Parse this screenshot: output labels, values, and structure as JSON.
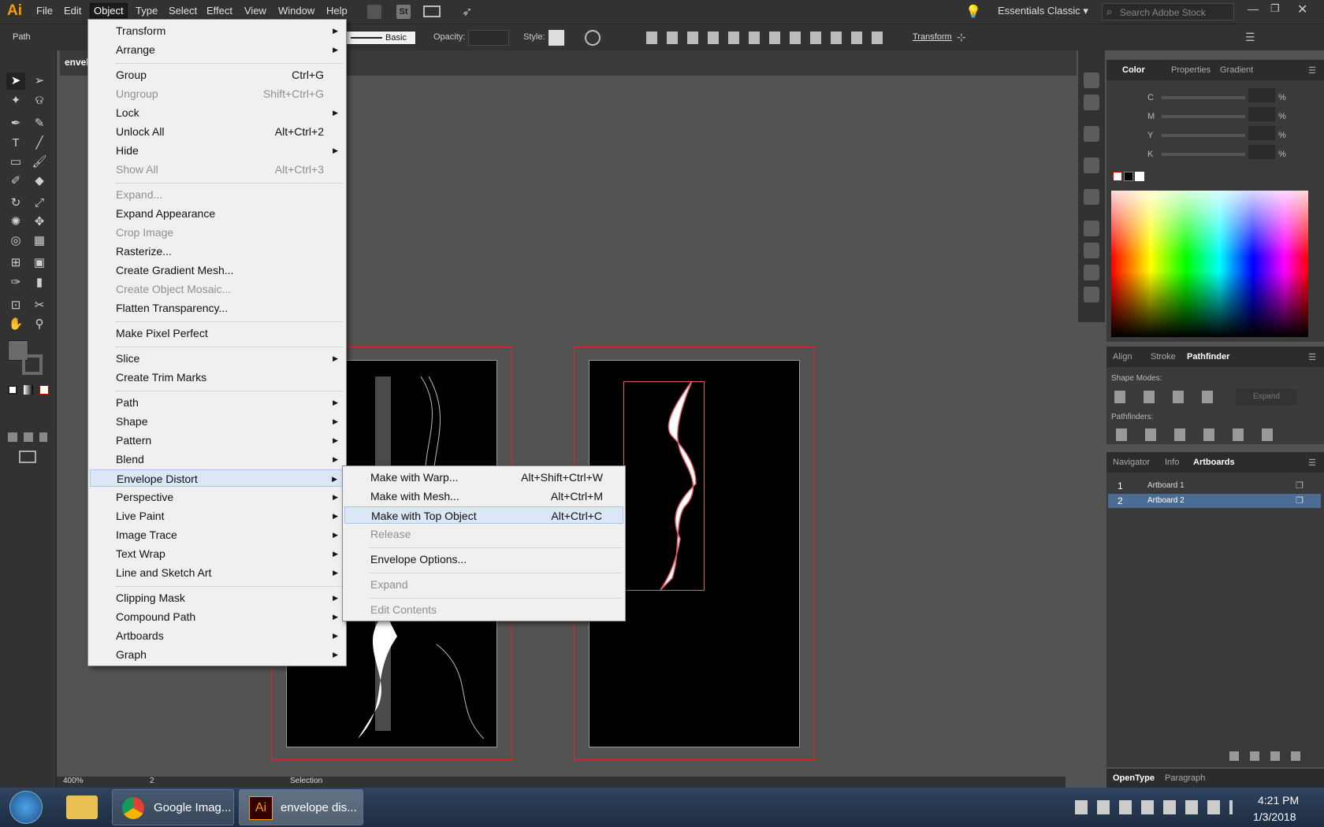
{
  "app": {
    "logo": "Ai",
    "document_tab": "envel"
  },
  "menubar": {
    "items": [
      "File",
      "Edit",
      "Object",
      "Type",
      "Select",
      "Effect",
      "View",
      "Window",
      "Help"
    ],
    "workspace": "Essentials Classic",
    "search_placeholder": "Search Adobe Stock"
  },
  "control": {
    "label": "Path",
    "stroke_style": "Basic",
    "opacity_label": "Opacity:",
    "style_label": "Style:",
    "transform": "Transform"
  },
  "object_menu": [
    {
      "label": "Transform",
      "shortcut": "",
      "submenu": true,
      "disabled": false
    },
    {
      "label": "Arrange",
      "shortcut": "",
      "submenu": true,
      "disabled": false
    },
    {
      "separator": true
    },
    {
      "label": "Group",
      "shortcut": "Ctrl+G",
      "submenu": false,
      "disabled": false
    },
    {
      "label": "Ungroup",
      "shortcut": "Shift+Ctrl+G",
      "submenu": false,
      "disabled": true
    },
    {
      "label": "Lock",
      "shortcut": "",
      "submenu": true,
      "disabled": false
    },
    {
      "label": "Unlock All",
      "shortcut": "Alt+Ctrl+2",
      "submenu": false,
      "disabled": false
    },
    {
      "label": "Hide",
      "shortcut": "",
      "submenu": true,
      "disabled": false
    },
    {
      "label": "Show All",
      "shortcut": "Alt+Ctrl+3",
      "submenu": false,
      "disabled": true
    },
    {
      "separator": true
    },
    {
      "label": "Expand...",
      "shortcut": "",
      "submenu": false,
      "disabled": true
    },
    {
      "label": "Expand Appearance",
      "shortcut": "",
      "submenu": false,
      "disabled": false
    },
    {
      "label": "Crop Image",
      "shortcut": "",
      "submenu": false,
      "disabled": true
    },
    {
      "label": "Rasterize...",
      "shortcut": "",
      "submenu": false,
      "disabled": false
    },
    {
      "label": "Create Gradient Mesh...",
      "shortcut": "",
      "submenu": false,
      "disabled": false
    },
    {
      "label": "Create Object Mosaic...",
      "shortcut": "",
      "submenu": false,
      "disabled": true
    },
    {
      "label": "Flatten Transparency...",
      "shortcut": "",
      "submenu": false,
      "disabled": false
    },
    {
      "separator": true
    },
    {
      "label": "Make Pixel Perfect",
      "shortcut": "",
      "submenu": false,
      "disabled": false
    },
    {
      "separator": true
    },
    {
      "label": "Slice",
      "shortcut": "",
      "submenu": true,
      "disabled": false
    },
    {
      "label": "Create Trim Marks",
      "shortcut": "",
      "submenu": false,
      "disabled": false
    },
    {
      "separator": true
    },
    {
      "label": "Path",
      "shortcut": "",
      "submenu": true,
      "disabled": false
    },
    {
      "label": "Shape",
      "shortcut": "",
      "submenu": true,
      "disabled": false
    },
    {
      "label": "Pattern",
      "shortcut": "",
      "submenu": true,
      "disabled": false
    },
    {
      "label": "Blend",
      "shortcut": "",
      "submenu": true,
      "disabled": false
    },
    {
      "label": "Envelope Distort",
      "shortcut": "",
      "submenu": true,
      "disabled": false,
      "highlighted": true
    },
    {
      "label": "Perspective",
      "shortcut": "",
      "submenu": true,
      "disabled": false
    },
    {
      "label": "Live Paint",
      "shortcut": "",
      "submenu": true,
      "disabled": false
    },
    {
      "label": "Image Trace",
      "shortcut": "",
      "submenu": true,
      "disabled": false
    },
    {
      "label": "Text Wrap",
      "shortcut": "",
      "submenu": true,
      "disabled": false
    },
    {
      "label": "Line and Sketch Art",
      "shortcut": "",
      "submenu": true,
      "disabled": false
    },
    {
      "separator": true
    },
    {
      "label": "Clipping Mask",
      "shortcut": "",
      "submenu": true,
      "disabled": false
    },
    {
      "label": "Compound Path",
      "shortcut": "",
      "submenu": true,
      "disabled": false
    },
    {
      "label": "Artboards",
      "shortcut": "",
      "submenu": true,
      "disabled": false
    },
    {
      "label": "Graph",
      "shortcut": "",
      "submenu": true,
      "disabled": false
    }
  ],
  "envelope_menu": [
    {
      "label": "Make with Warp...",
      "shortcut": "Alt+Shift+Ctrl+W",
      "disabled": false
    },
    {
      "label": "Make with Mesh...",
      "shortcut": "Alt+Ctrl+M",
      "disabled": false
    },
    {
      "label": "Make with Top Object",
      "shortcut": "Alt+Ctrl+C",
      "disabled": false,
      "highlighted": true
    },
    {
      "label": "Release",
      "shortcut": "",
      "disabled": true
    },
    {
      "separator": true
    },
    {
      "label": "Envelope Options...",
      "shortcut": "",
      "disabled": false
    },
    {
      "separator": true
    },
    {
      "label": "Expand",
      "shortcut": "",
      "disabled": true
    },
    {
      "separator": true
    },
    {
      "label": "Edit Contents",
      "shortcut": "",
      "disabled": true
    }
  ],
  "color_panel": {
    "tabs": [
      "Color",
      "Properties",
      "Gradient"
    ],
    "channels": [
      "C",
      "M",
      "Y",
      "K"
    ],
    "unit": "%"
  },
  "pathfinder_panel": {
    "tabs": [
      "Align",
      "Stroke",
      "Pathfinder"
    ],
    "shape_modes": "Shape Modes:",
    "pathfinders": "Pathfinders:",
    "expand": "Expand"
  },
  "artboards_panel": {
    "tabs": [
      "Navigator",
      "Info",
      "Artboards"
    ],
    "rows": [
      {
        "num": "1",
        "name": "Artboard 1",
        "selected": false
      },
      {
        "num": "2",
        "name": "Artboard 2",
        "selected": true
      }
    ]
  },
  "type_panel": {
    "tabs": [
      "OpenType",
      "Paragraph"
    ]
  },
  "statusbar": {
    "zoom": "400%",
    "artboard": "2",
    "tool": "Selection"
  },
  "taskbar": {
    "chrome": "Google Imag...",
    "illustrator": "envelope dis...",
    "time": "4:21 PM",
    "date": "1/3/2018"
  },
  "colors": {
    "chrome_dark": "#323232",
    "canvas": "#535353",
    "artboard_border": "#e0262c",
    "selection": "#e0606a"
  }
}
